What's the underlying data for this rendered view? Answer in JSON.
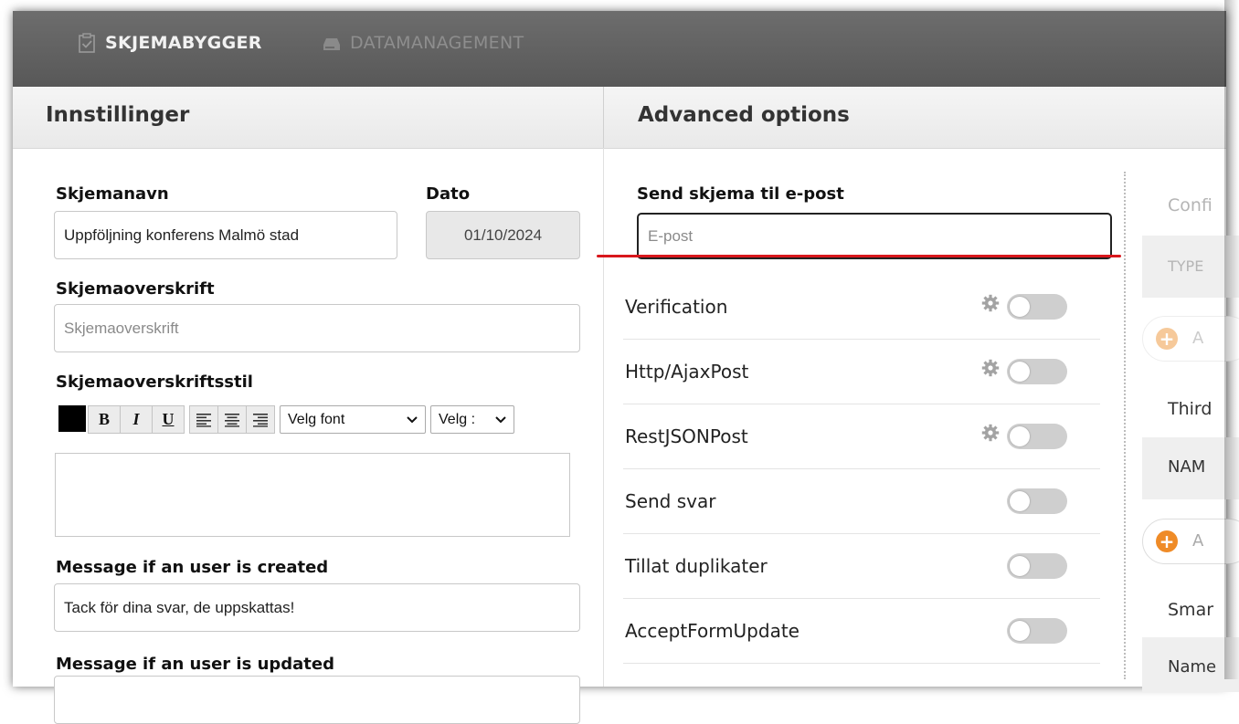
{
  "nav": {
    "skjemabygger": "SKJEMABYGGER",
    "datamanagement": "DATAMANAGEMENT"
  },
  "left": {
    "title": "Innstillinger",
    "skjemanavn_label": "Skjemanavn",
    "skjemanavn_value": "Uppföljning konferens Malmö stad",
    "dato_label": "Dato",
    "dato_value": "01/10/2024",
    "overskrift_label": "Skjemaoverskrift",
    "overskrift_placeholder": "Skjemaoverskrift",
    "stil_label": "Skjemaoverskriftsstil",
    "toolbar": {
      "bold": "B",
      "italic": "I",
      "underline": "U",
      "font_select": "Velg font",
      "size_select": "Velg :"
    },
    "msg_created_label": "Message if an user is created",
    "msg_created_value": "Tack för dina svar, de uppskattas!",
    "msg_updated_label": "Message if an user is updated"
  },
  "right": {
    "title": "Advanced options",
    "email_label": "Send skjema til e-post",
    "email_placeholder": "E-post",
    "options": [
      {
        "label": "Verification",
        "gear": true,
        "enabled": false
      },
      {
        "label": "Http/AjaxPost",
        "gear": true,
        "enabled": false
      },
      {
        "label": "RestJSONPost",
        "gear": true,
        "enabled": false
      },
      {
        "label": "Send svar",
        "gear": false,
        "enabled": false
      },
      {
        "label": "Tillat duplikater",
        "gear": false,
        "enabled": false
      },
      {
        "label": "AcceptFormUpdate",
        "gear": false,
        "enabled": false
      }
    ]
  },
  "far_right": {
    "confi": "Confi",
    "type": "TYPE",
    "btn1_text": "A",
    "third": "Third",
    "nam": "NAM",
    "btn2_text": "A",
    "smar": "Smar",
    "name": "Name"
  },
  "colors": {
    "topbar": "#636363",
    "accent_red": "#d8171c",
    "plus_orange": "#f0a24a",
    "plus_orange_active": "#ef8b27"
  }
}
